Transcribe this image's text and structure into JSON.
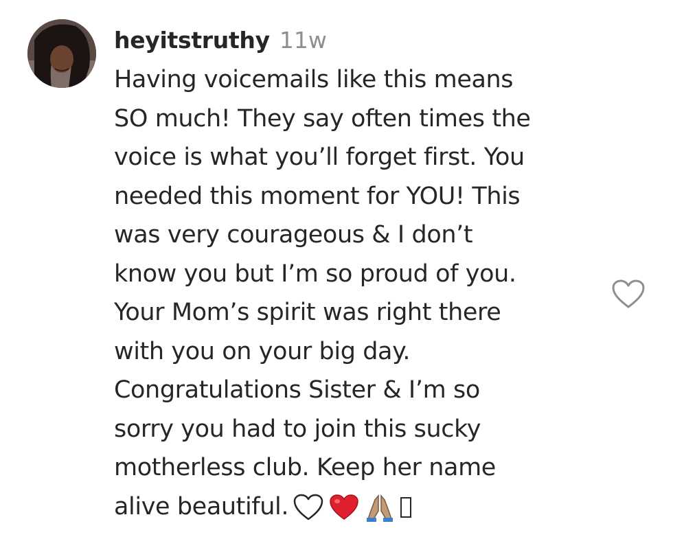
{
  "comment": {
    "username": "heyitstruthy",
    "time": "11w",
    "lines": [
      "Having voicemails like this means",
      "SO much! They say often times the",
      "voice is what you’ll forget first. You",
      "needed this moment for YOU! This",
      "was very courageous & I don’t",
      "know you but I’m so proud of you.",
      "Your Mom’s spirit was right there",
      "with you on your big day.",
      "Congratulations Sister & I’m so",
      "sorry you had to join this sucky",
      "motherless club. Keep her name",
      "alive beautiful."
    ],
    "emojis": [
      "white-heart-icon",
      "red-heart-icon",
      "folded-hands-icon",
      "missing-glyph-icon"
    ]
  },
  "colors": {
    "text": "#262626",
    "muted": "#8e8e8e",
    "red_heart": "#e0202e"
  },
  "icons": {
    "like": "heart-outline-icon",
    "avatar": "avatar"
  }
}
